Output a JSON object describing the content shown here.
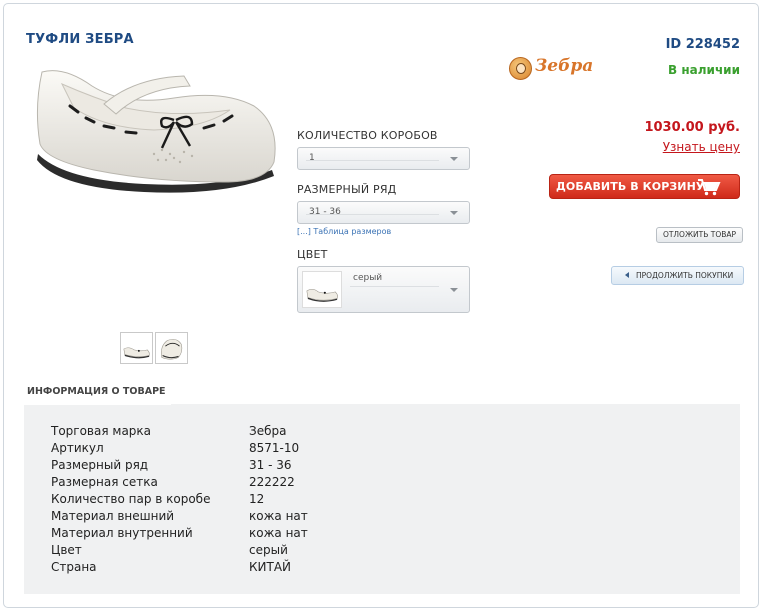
{
  "product": {
    "title": "ТУФЛИ ЗЕБРА",
    "id_label": "ID 228452",
    "availability": "В наличии",
    "price": "1030.00 руб.",
    "ask_price_link": "Узнать цену",
    "brand_logo_text": "Зебра",
    "image": "white-girls-ballet-flat-shoe-with-black-bow"
  },
  "options": {
    "boxes": {
      "label": "КОЛИЧЕСТВО КОРОБОВ",
      "value": "1"
    },
    "size_range": {
      "label": "РАЗМЕРНЫЙ РЯД",
      "value": "31 - 36",
      "size_table_link": "[...] Таблица размеров"
    },
    "color": {
      "label": "ЦВЕТ",
      "value": "серый"
    }
  },
  "buttons": {
    "add_to_cart": "ДОБАВИТЬ В КОРЗИНУ",
    "defer": "ОТЛОЖИТЬ ТОВАР",
    "continue": "ПРОДОЛЖИТЬ ПОКУПКИ"
  },
  "info": {
    "tab_label": "ИНФОРМАЦИЯ О ТОВАРЕ",
    "rows": [
      {
        "key": "Торговая марка",
        "value": "Зебра"
      },
      {
        "key": "Артикул",
        "value": "8571-10"
      },
      {
        "key": "Размерный ряд",
        "value": "31 - 36"
      },
      {
        "key": "Размерная сетка",
        "value": "222222"
      },
      {
        "key": "Количество пар в коробе",
        "value": "12"
      },
      {
        "key": "Материал внешний",
        "value": "кожа нат"
      },
      {
        "key": "Материал внутренний",
        "value": "кожа нат"
      },
      {
        "key": "Цвет",
        "value": "серый"
      },
      {
        "key": "Страна",
        "value": "КИТАЙ"
      }
    ]
  },
  "colors": {
    "title": "#1f4b83",
    "in_stock": "#3aa02f",
    "price": "#c4161c",
    "cart_button": "#d9301f",
    "panel_bg": "#f0f1f2"
  },
  "icons": [
    "shopping-cart-icon",
    "chevron-down-icon",
    "left-triangle-icon",
    "brand-logo"
  ]
}
